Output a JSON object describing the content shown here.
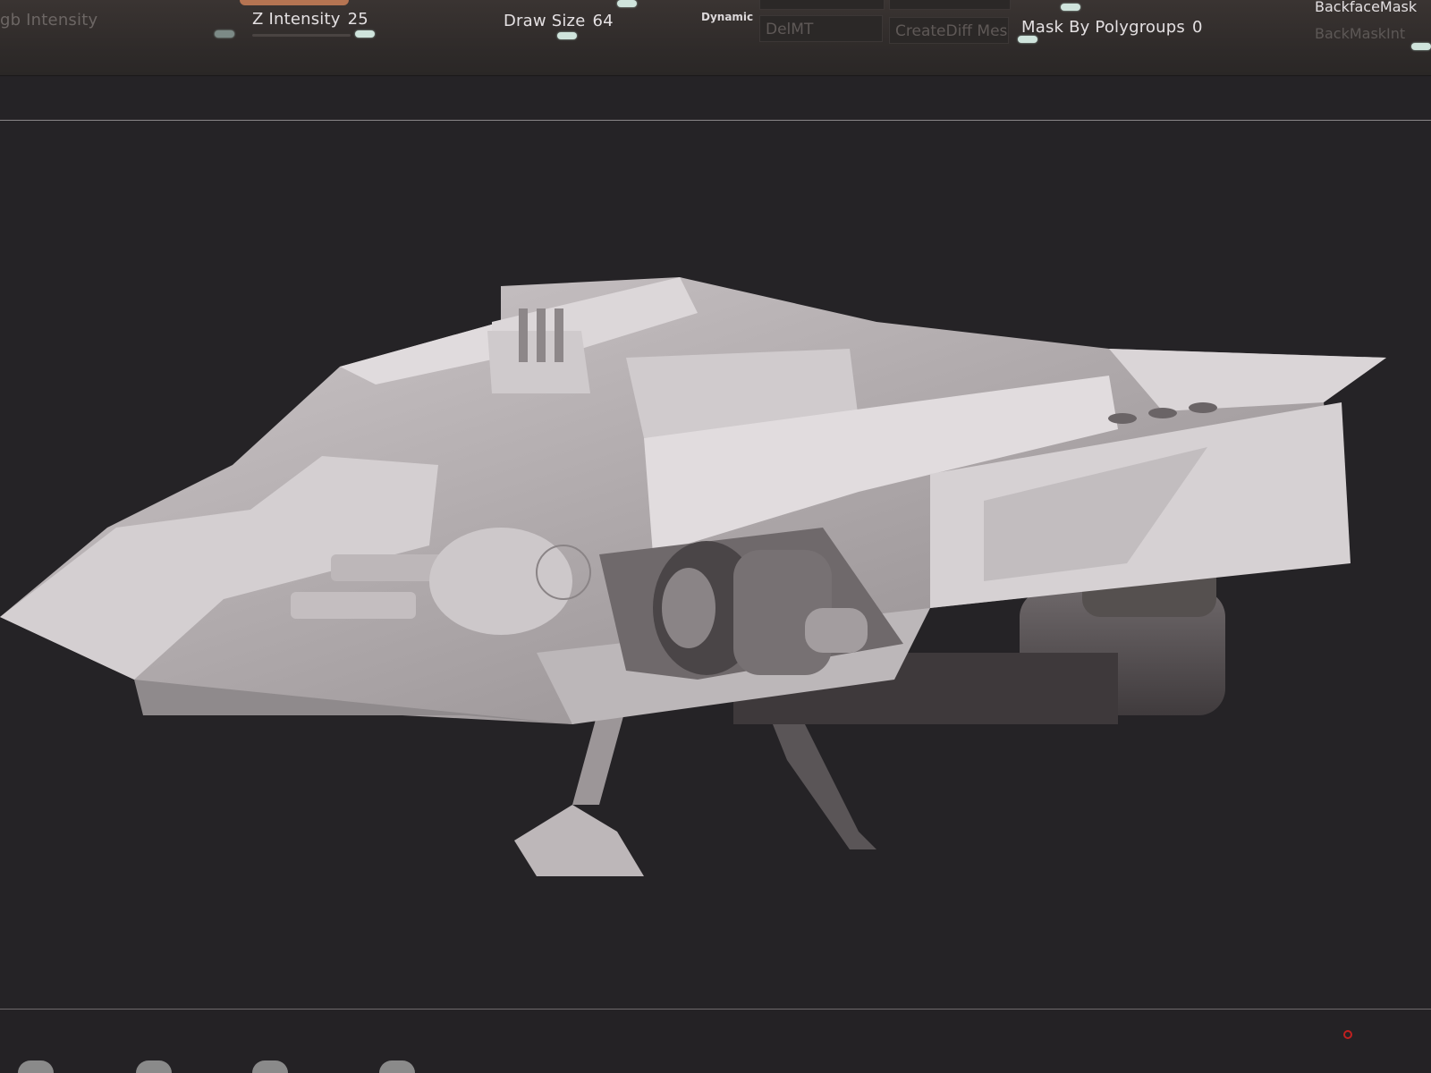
{
  "shelf": {
    "rgb_intensity_label": "gb Intensity",
    "z_intensity_label": "Z Intensity",
    "z_intensity_value": "25",
    "draw_size_label": "Draw Size",
    "draw_size_value": "64",
    "dynamic_label": "Dynamic",
    "del_mt_label": "DelMT",
    "create_diff_mesh_label": "CreateDiff Mesl",
    "mask_by_polygroups_label": "Mask By Polygroups",
    "mask_by_polygroups_value": "0",
    "backface_mask_label": "BackfaceMask",
    "back_mask_int_label": "BackMaskInt",
    "accent_color": "#b57452",
    "knob_color": "#cfe4dc"
  },
  "viewport": {
    "background": "#252326",
    "model_color": "#c9c4c6"
  }
}
